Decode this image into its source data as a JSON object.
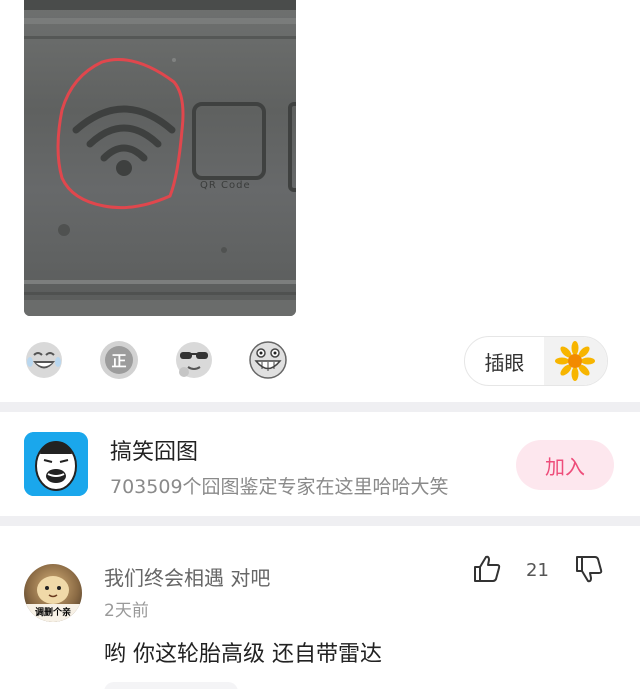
{
  "post": {
    "image_caption": "QR Code"
  },
  "reactions": {
    "emojis": [
      "laughing-face-icon",
      "zheng-badge-icon",
      "sunglasses-face-icon",
      "grinning-face-icon"
    ],
    "insert_label": "插眼"
  },
  "group": {
    "name": "搞笑囧图",
    "description": "703509个囧图鉴定专家在这里哈哈大笑",
    "join_label": "加入"
  },
  "comment": {
    "username": "我们终会相遇 对吧",
    "time": "2天前",
    "text": "哟 你这轮胎高级 还自带雷达",
    "like_count": "21",
    "avatar_caption": "调删个亲"
  },
  "colors": {
    "accent_pink": "#ee4d7a",
    "join_bg": "#fde7ee",
    "group_avatar_bg": "#1aa7ec",
    "divider": "#efeff2"
  }
}
